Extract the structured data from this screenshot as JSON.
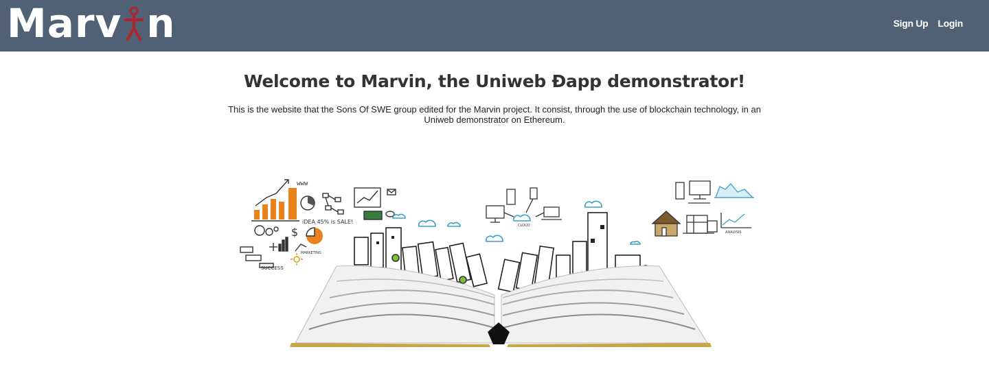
{
  "navbar": {
    "brand": {
      "part1": "Marv",
      "part2": "n"
    },
    "links": [
      {
        "label": "Sign Up",
        "icon": null
      },
      {
        "label": "Login",
        "icon": null
      }
    ],
    "colors": {
      "background": "#506176",
      "brand_accent": "#b0262b"
    }
  },
  "main": {
    "title": "Welcome to Marvin, the Uniweb Đapp demonstrator!",
    "intro": "This is the website that the Sons Of SWE group edited for the Marvin project. It consist, through the use of blockchain technology, in an Uniweb demonstrator on Ethereum.",
    "hero": {
      "icon": "open-book-city-illustration",
      "labels": {
        "www": "www",
        "idea": "iDEA 45% is SALE!",
        "success": "SUCCESS",
        "marketing": "MARKETING",
        "cloud": "CLOUD",
        "analysis": "ANALYSIS"
      }
    }
  }
}
